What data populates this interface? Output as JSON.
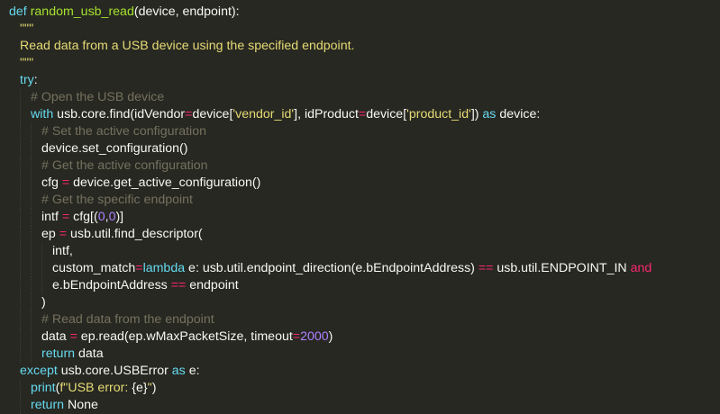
{
  "code": {
    "l1": [
      "def",
      "random_usb_read",
      "(device, endpoint):"
    ],
    "l2": [
      "\"\"\""
    ],
    "l3": [
      "Read data from a USB device using the specified endpoint."
    ],
    "l4": [
      "\"\"\""
    ],
    "l5": [
      "try",
      ":"
    ],
    "l6": [
      "# Open the USB device"
    ],
    "l7": [
      "with",
      " usb.core.find(idVendor",
      "=",
      "device[",
      "'vendor_id'",
      "], idProduct",
      "=",
      "device[",
      "'product_id'",
      "]) ",
      "as",
      " device:"
    ],
    "l8": [
      "# Set the active configuration"
    ],
    "l9": [
      "device.set_configuration()"
    ],
    "l10": [
      "# Get the active configuration"
    ],
    "l11": [
      "cfg ",
      "=",
      " device.get_active_configuration()"
    ],
    "l12": [
      "# Get the specific endpoint"
    ],
    "l13": [
      "intf ",
      "=",
      " cfg[(",
      "0",
      ",",
      "0",
      ")]"
    ],
    "l14": [
      "ep ",
      "=",
      " usb.util.find_descriptor("
    ],
    "l15": [
      "intf,"
    ],
    "l16": [
      "custom_match",
      "=",
      "lambda",
      " e: usb.util.endpoint_direction(e.bEndpointAddress) ",
      "==",
      " usb.util.ENDPOINT_IN ",
      "and"
    ],
    "l17": [
      "e.bEndpointAddress ",
      "==",
      " endpoint"
    ],
    "l18": [
      ")"
    ],
    "l19": [
      "# Read data from the endpoint"
    ],
    "l20": [
      "data ",
      "=",
      " ep.read(ep.wMaxPacketSize, timeout",
      "=",
      "2000",
      ")"
    ],
    "l21": [
      "return",
      " data"
    ],
    "l22": [
      "except",
      " usb.core.USBError ",
      "as",
      " e:"
    ],
    "l23": [
      "print",
      "(",
      "f\"USB error: ",
      "{e}",
      "\"",
      ")"
    ],
    "l24": [
      "return",
      " None"
    ]
  },
  "theme": {
    "background": "#272822",
    "foreground": "#f8f8f2",
    "keyword": "#66d9ef",
    "function": "#a6e22e",
    "string": "#e6db74",
    "operator": "#f92672",
    "number": "#ae81ff",
    "comment": "#75715e"
  }
}
